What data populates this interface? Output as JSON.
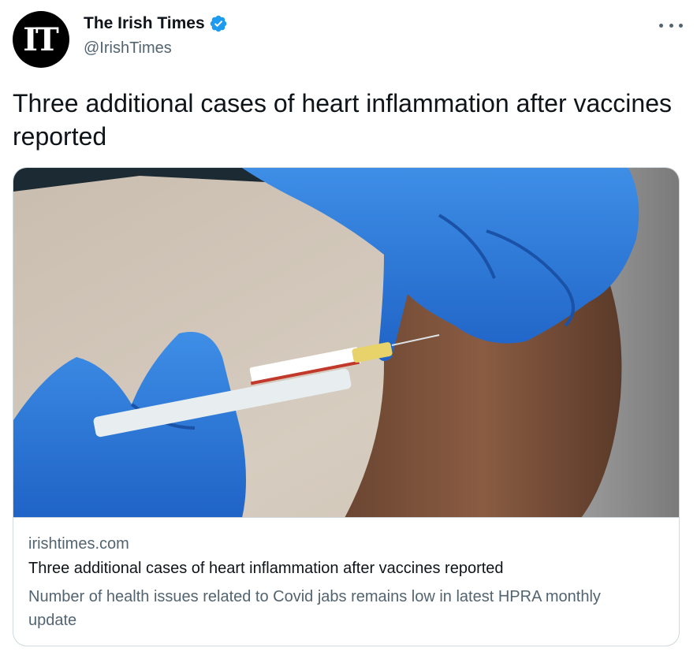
{
  "tweet": {
    "author": {
      "avatar_text": "IT",
      "display_name": "The Irish Times",
      "handle": "@IrishTimes",
      "verified": true
    },
    "text": "Three additional cases of heart inflammation after vaccines reported",
    "more_icon": "ellipsis-icon"
  },
  "card": {
    "image_alt": "Gloved hands administering a COVID-19 vaccine injection into an upper arm",
    "domain": "irishtimes.com",
    "title": "Three additional cases of heart inflammation after vaccines reported",
    "description": "Number of health issues related to Covid jabs remains low in latest HPRA monthly update"
  },
  "colors": {
    "text_primary": "#0f1419",
    "text_secondary": "#536471",
    "verified_blue": "#1d9bf0",
    "border": "#cfd9de"
  }
}
